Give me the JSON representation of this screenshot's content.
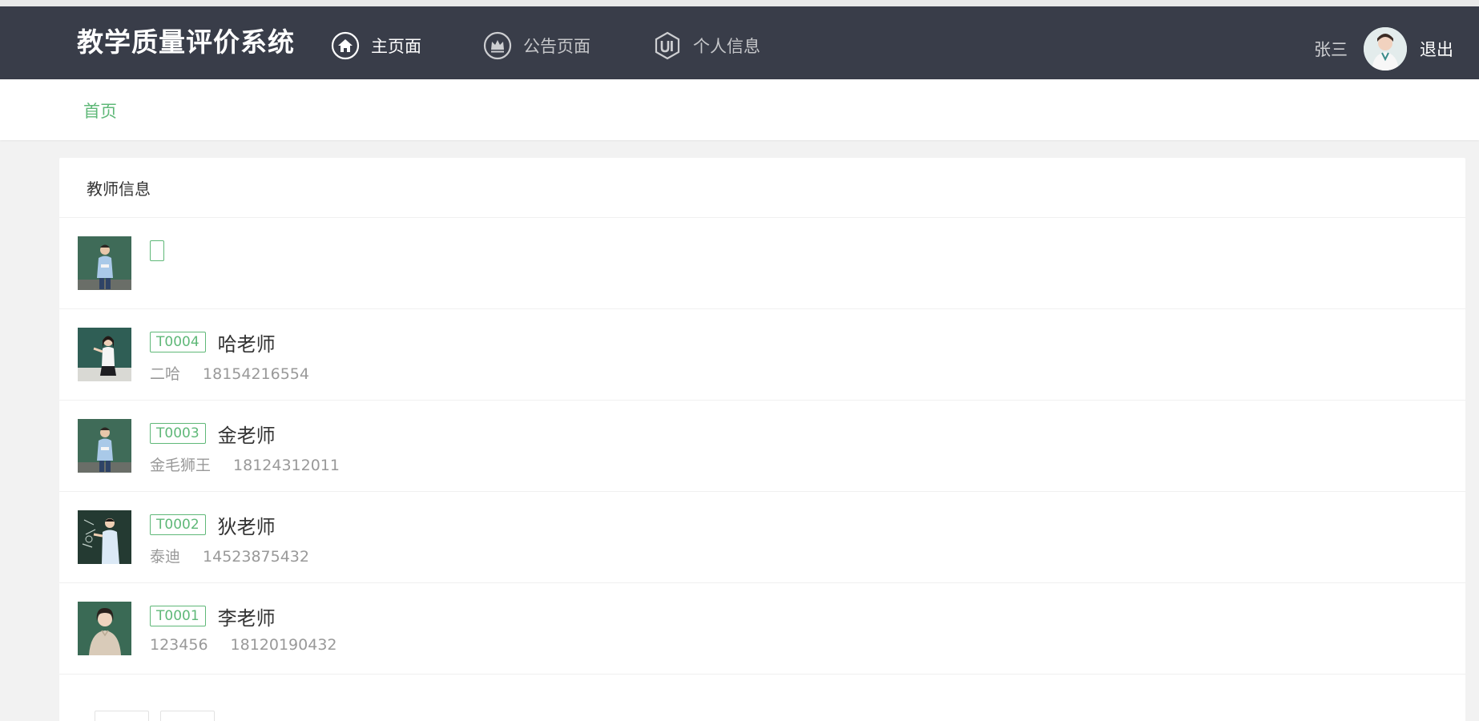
{
  "header": {
    "brand": "教学质量评价系统",
    "nav": [
      {
        "label": "主页面",
        "icon": "home-icon",
        "active": true
      },
      {
        "label": "公告页面",
        "icon": "crown-icon",
        "active": false
      },
      {
        "label": "个人信息",
        "icon": "ui-shield-icon",
        "active": false
      }
    ],
    "user_name": "张三",
    "logout_label": "退出"
  },
  "breadcrumb": {
    "home": "首页"
  },
  "teachers_panel": {
    "title": "教师信息",
    "items": [
      {
        "id": "",
        "name": "",
        "username": "",
        "phone": ""
      },
      {
        "id": "T0004",
        "name": "哈老师",
        "username": "二哈",
        "phone": "18154216554"
      },
      {
        "id": "T0003",
        "name": "金老师",
        "username": "金毛狮王",
        "phone": "18124312011"
      },
      {
        "id": "T0002",
        "name": "狄老师",
        "username": "泰迪",
        "phone": "14523875432"
      },
      {
        "id": "T0001",
        "name": "李老师",
        "username": "123456",
        "phone": "18120190432"
      }
    ]
  },
  "colors": {
    "header_bg": "#393d49",
    "accent": "#5fb878",
    "muted_text": "#999999"
  }
}
